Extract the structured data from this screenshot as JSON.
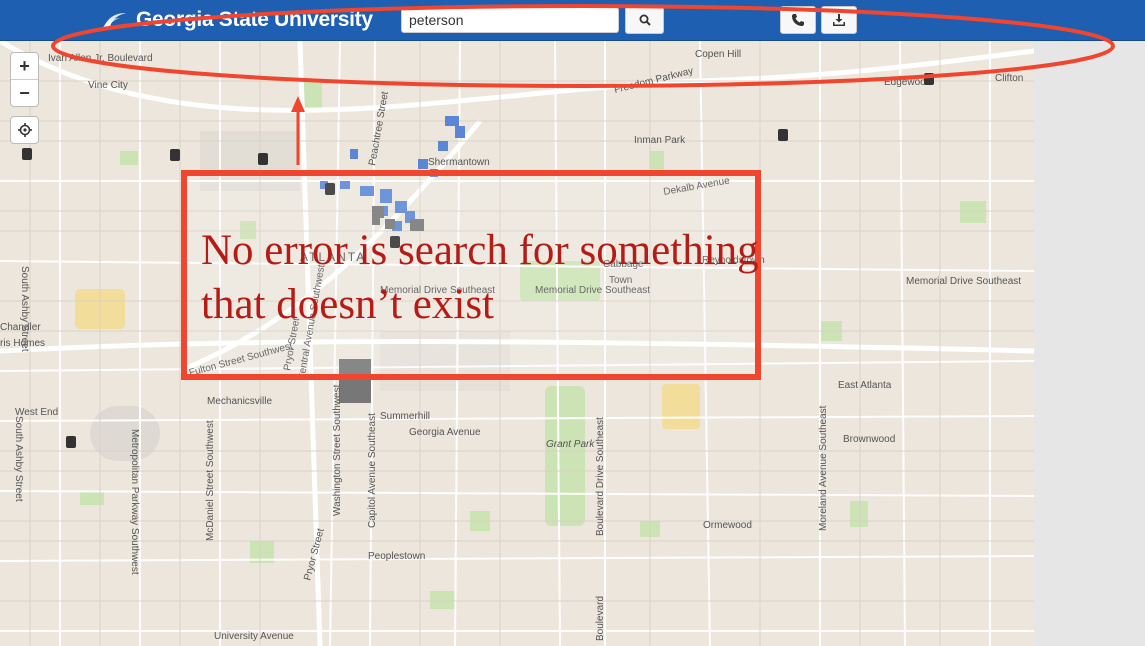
{
  "header": {
    "brand": "Georgia State University",
    "search_value": "peterson",
    "search_button_icon": "search-icon",
    "phone_button_icon": "phone-icon",
    "download_button_icon": "download-icon",
    "color": "#1f5fb2"
  },
  "map_controls": {
    "zoom_in": "+",
    "zoom_out": "−",
    "locate_icon": "crosshair-icon"
  },
  "map_labels": [
    "Ivan Allen Jr. Boulevard",
    "Vine City",
    "Freedom Parkway",
    "Copen Hill",
    "Edgewood",
    "Clifton",
    "Peachtree Street",
    "Shermantown",
    "Inman Park",
    "Dekalb Avenue",
    "South Ashby Street",
    "ATLANTA",
    "Cabbage Town",
    "Reynoldstown",
    "Memorial Drive Southeast",
    "Memorial Drive Southeast",
    "Memorial Drive Southeast",
    "Chandler",
    "ris Homes",
    "Pryor Street",
    "Central Avenue Southwest",
    "Capitol Avenue Southeast",
    "Fulton Street Southwest",
    "Mechanicsville",
    "West End",
    "East Atlanta",
    "Summerhill",
    "Georgia Avenue",
    "Grant Park",
    "Brownwood",
    "South Ashby Street",
    "Metropolitan Parkway Southwest",
    "McDaniel Street Southwest",
    "Washington Street Southwest",
    "Capitol Avenue Southeast",
    "Boulevard Drive Southeast",
    "Moreland Avenue Southeast",
    "Ormewood",
    "Peoplestown",
    "Pryor Street",
    "University Avenue",
    "Boulevard"
  ],
  "annotation": {
    "text": "No error is search for something that doesn’t exist",
    "color": "#f0452e"
  }
}
